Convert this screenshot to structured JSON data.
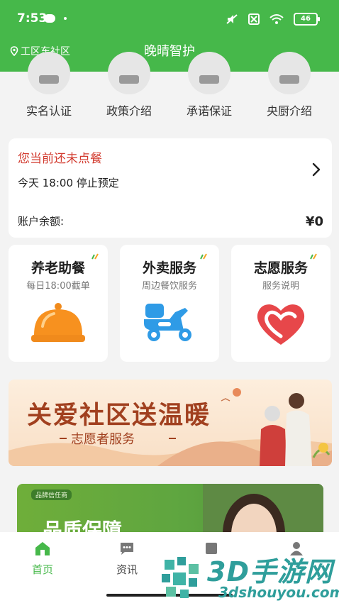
{
  "status_bar": {
    "time": "7:53",
    "battery": "46"
  },
  "header": {
    "location": "工区东社区",
    "title": "晚晴智护"
  },
  "quick_menu": [
    {
      "label": "实名认证"
    },
    {
      "label": "政策介绍"
    },
    {
      "label": "承诺保证"
    },
    {
      "label": "央厨介绍"
    }
  ],
  "order": {
    "status": "您当前还未点餐",
    "deadline": "今天 18:00 停止预定",
    "balance_label": "账户余额:",
    "balance_value": "¥0"
  },
  "services": [
    {
      "title": "养老助餐",
      "subtitle": "每日18:00截单"
    },
    {
      "title": "外卖服务",
      "subtitle": "周边餐饮服务"
    },
    {
      "title": "志愿服务",
      "subtitle": "服务说明"
    }
  ],
  "banner": {
    "title": "关爱社区送温暖",
    "subtitle": "志愿者服务"
  },
  "promo": {
    "badge": "品牌信任商",
    "title": "品质保障"
  },
  "bottom_nav": [
    {
      "label": "首页"
    },
    {
      "label": "资讯"
    }
  ],
  "watermark": {
    "text": "3D手游网",
    "url": "3dshouyou.com"
  },
  "colors": {
    "brand": "#46b84a",
    "alert": "#d23a2e",
    "banner_text": "#a1401f"
  }
}
